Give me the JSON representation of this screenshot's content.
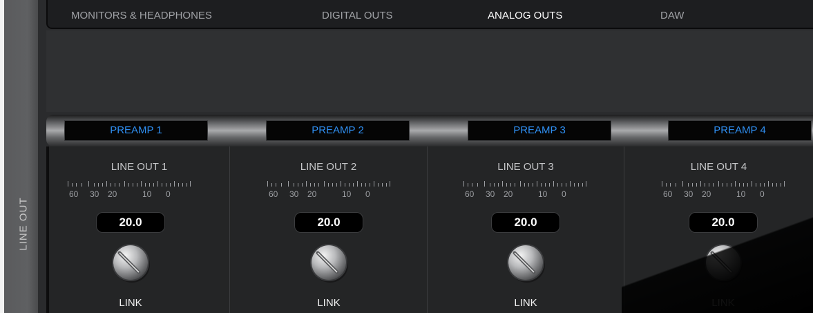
{
  "side": {
    "label": "LINE OUT"
  },
  "tabs": [
    {
      "label": "MONITORS & HEADPHONES",
      "active": false
    },
    {
      "label": "DIGITAL OUTS",
      "active": false
    },
    {
      "label": "ANALOG OUTS",
      "active": true
    },
    {
      "label": "DAW",
      "active": false
    }
  ],
  "preamps": [
    "PREAMP 1",
    "PREAMP 2",
    "PREAMP 3",
    "PREAMP 4"
  ],
  "channels": [
    {
      "title": "LINE OUT 1",
      "value": "20.0",
      "link": "LINK"
    },
    {
      "title": "LINE OUT 2",
      "value": "20.0",
      "link": "LINK"
    },
    {
      "title": "LINE OUT 3",
      "value": "20.0",
      "link": "LINK"
    },
    {
      "title": "LINE OUT 4",
      "value": "20.0",
      "link": "LINK"
    }
  ],
  "meter_scale": [
    "60",
    "30",
    "20",
    "10",
    "0"
  ],
  "colors": {
    "accent_blue": "#2f8ff2",
    "active_tab": "#ffffff",
    "tab_inactive": "#a0a2a6"
  },
  "icons": {
    "knob": "knob-icon",
    "meter": "level-meter-scale"
  }
}
